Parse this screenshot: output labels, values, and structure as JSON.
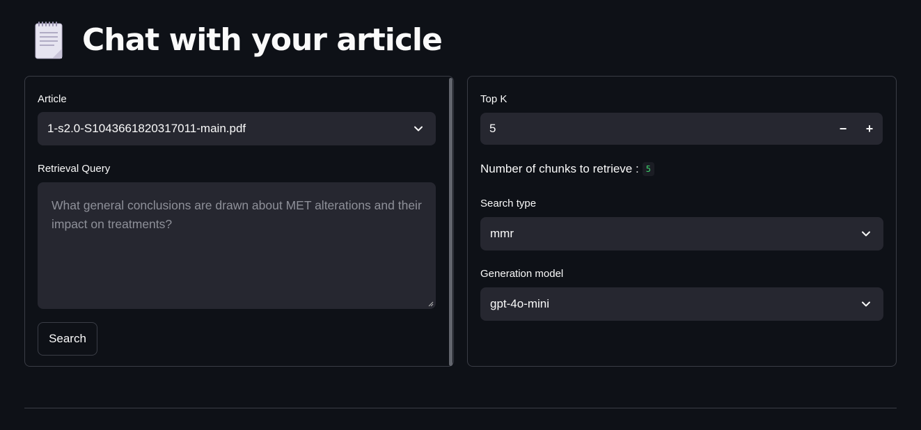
{
  "header": {
    "title": "Chat with your article",
    "icon": "notepad-icon"
  },
  "left_panel": {
    "article_label": "Article",
    "article_value": "1-s2.0-S1043661820317011-main.pdf",
    "query_label": "Retrieval Query",
    "query_placeholder": "What general conclusions are drawn about MET alterations and their impact on treatments?",
    "search_button": "Search"
  },
  "right_panel": {
    "topk_label": "Top K",
    "topk_value": "5",
    "decrement_label": "−",
    "increment_label": "+",
    "chunks_text": "Number of chunks to retrieve :",
    "chunks_value": "5",
    "search_type_label": "Search type",
    "search_type_value": "mmr",
    "model_label": "Generation model",
    "model_value": "gpt-4o-mini"
  },
  "colors": {
    "background": "#0e1117",
    "input_bg": "#262730",
    "border": "#3a3d46",
    "code_green": "#3dd56d"
  }
}
